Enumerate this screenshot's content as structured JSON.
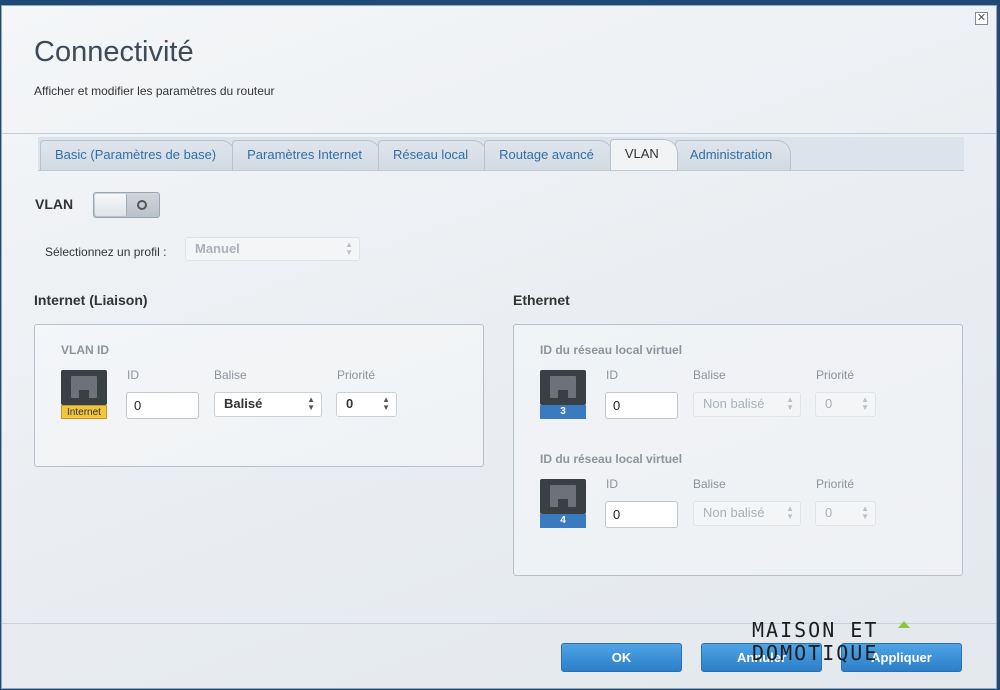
{
  "window": {
    "title": "Connectivité",
    "subtitle": "Afficher et modifier les paramètres du routeur",
    "close_glyph": "✕"
  },
  "tabs": [
    {
      "label": "Basic (Paramètres de base)",
      "active": false
    },
    {
      "label": "Paramètres Internet",
      "active": false
    },
    {
      "label": "Réseau local",
      "active": false
    },
    {
      "label": "Routage avancé",
      "active": false
    },
    {
      "label": "VLAN",
      "active": true
    },
    {
      "label": "Administration",
      "active": false
    }
  ],
  "vlan": {
    "label": "VLAN",
    "toggle_on": false
  },
  "profile": {
    "label": "Sélectionnez un profil :",
    "value": "Manuel"
  },
  "internet": {
    "section_title": "Internet (Liaison)",
    "group_title": "VLAN ID",
    "port_label": "Internet",
    "id_label": "ID",
    "tag_label": "Balise",
    "priority_label": "Priorité",
    "id_value": "0",
    "tag_value": "Balisé",
    "priority_value": "0"
  },
  "ethernet": {
    "section_title": "Ethernet",
    "groups": [
      {
        "title": "ID du réseau local virtuel",
        "port_number": "3",
        "id_label": "ID",
        "tag_label": "Balise",
        "priority_label": "Priorité",
        "id_value": "0",
        "tag_value": "Non balisé",
        "priority_value": "0"
      },
      {
        "title": "ID du réseau local virtuel",
        "port_number": "4",
        "id_label": "ID",
        "tag_label": "Balise",
        "priority_label": "Priorité",
        "id_value": "0",
        "tag_value": "Non balisé",
        "priority_value": "0"
      }
    ]
  },
  "footer": {
    "ok_label": "OK",
    "cancel_label": "Annuler",
    "apply_label": "Appliquer"
  },
  "watermark": {
    "line1": "MAISON ET",
    "line2": "DOMOTIQUE"
  },
  "colors": {
    "accent": "#2c7fc7",
    "tab_text": "#2f6ea8",
    "internet_tag": "#f2c53d",
    "lan_tag": "#3a7bbf"
  }
}
